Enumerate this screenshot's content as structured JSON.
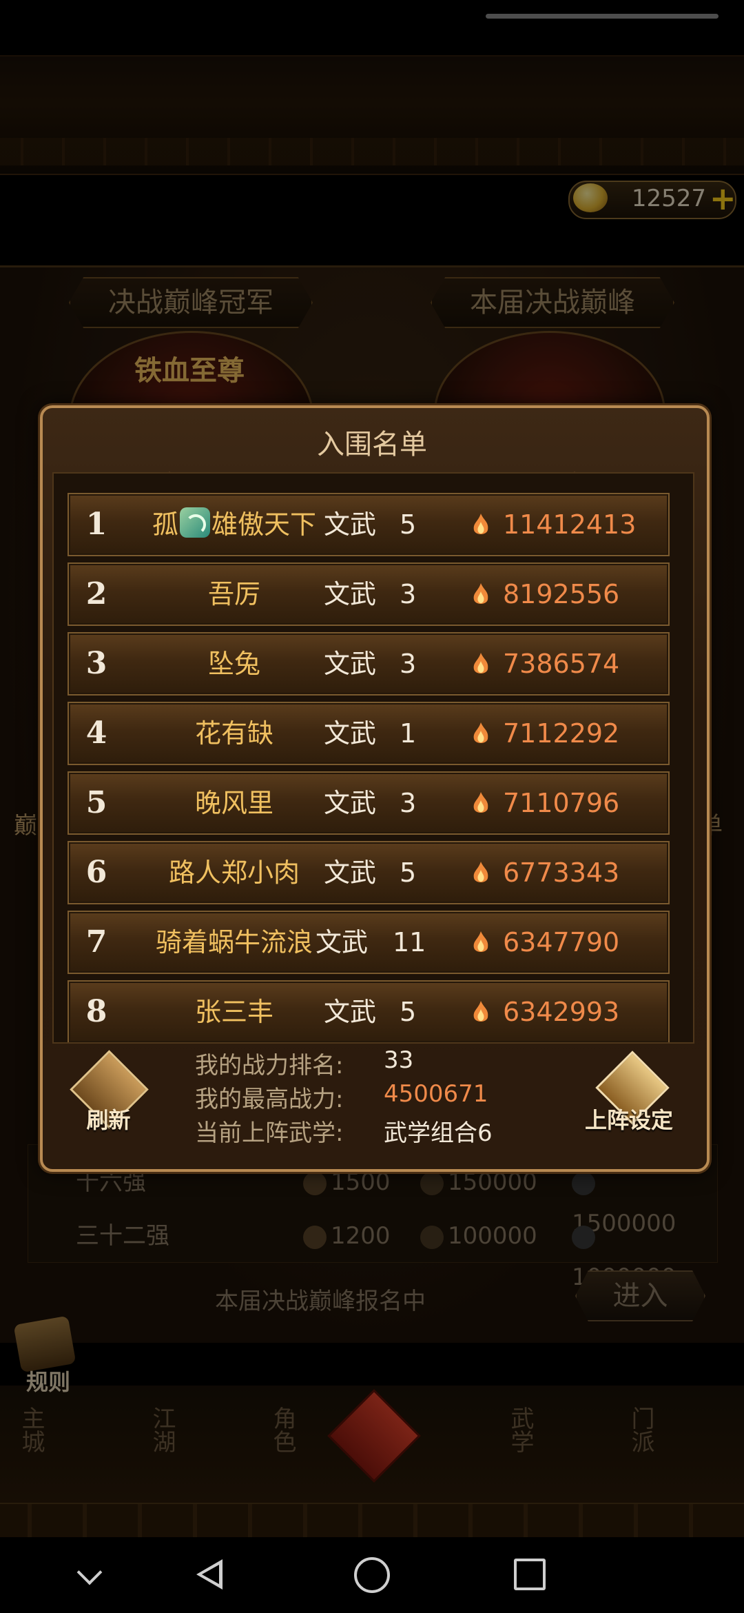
{
  "header": {
    "currency_value": "12527",
    "currency_icon": "gold-ingot-icon",
    "add_icon": "plus-icon"
  },
  "background": {
    "tab_left": "决战巅峰冠军",
    "tab_right": "本届决战巅峰",
    "emblem_left": "铁血至尊",
    "side_left": "巅",
    "side_right": "单",
    "rows": [
      {
        "label": "十六强",
        "v1": "1500",
        "v2": "150000",
        "v3": "1500000"
      },
      {
        "label": "三十二强",
        "v1": "1200",
        "v2": "100000",
        "v3": "1000000"
      }
    ],
    "status": "本届决战巅峰报名中",
    "enter_label": "进入",
    "rules_label": "规则",
    "nav": [
      "主城",
      "江湖",
      "角色",
      "武学",
      "门派"
    ]
  },
  "modal": {
    "title": "入围名单",
    "rows": [
      {
        "rank": "1",
        "name_pre": "孤",
        "name_post": "雄傲天下",
        "cls": "文武",
        "lvl": "5",
        "power": "11412413"
      },
      {
        "rank": "2",
        "name_pre": "",
        "name_post": "吾厉",
        "cls": "文武",
        "lvl": "3",
        "power": "8192556"
      },
      {
        "rank": "3",
        "name_pre": "",
        "name_post": "坠兔",
        "cls": "文武",
        "lvl": "3",
        "power": "7386574"
      },
      {
        "rank": "4",
        "name_pre": "",
        "name_post": "花有缺",
        "cls": "文武",
        "lvl": "1",
        "power": "7112292"
      },
      {
        "rank": "5",
        "name_pre": "",
        "name_post": "晚风里",
        "cls": "文武",
        "lvl": "3",
        "power": "7110796"
      },
      {
        "rank": "6",
        "name_pre": "",
        "name_post": "路人郑小肉",
        "cls": "文武",
        "lvl": "5",
        "power": "6773343"
      },
      {
        "rank": "7",
        "name_pre": "",
        "name_post": "骑着蜗牛流浪",
        "cls": "文武",
        "lvl": "11",
        "power": "6347790"
      },
      {
        "rank": "8",
        "name_pre": "",
        "name_post": "张三丰",
        "cls": "文武",
        "lvl": "5",
        "power": "6342993"
      }
    ],
    "refresh_label": "刷新",
    "deploy_label": "上阵设定",
    "info": [
      {
        "label": "我的战力排名:",
        "value": "33"
      },
      {
        "label": "我的最高战力:",
        "value": "4500671"
      },
      {
        "label": "当前上阵武学:",
        "value": "武学组合6"
      }
    ]
  },
  "colors": {
    "name_gold": "#f0c060",
    "power_orange": "#f08a4a",
    "modal_border": "#b88a52"
  }
}
